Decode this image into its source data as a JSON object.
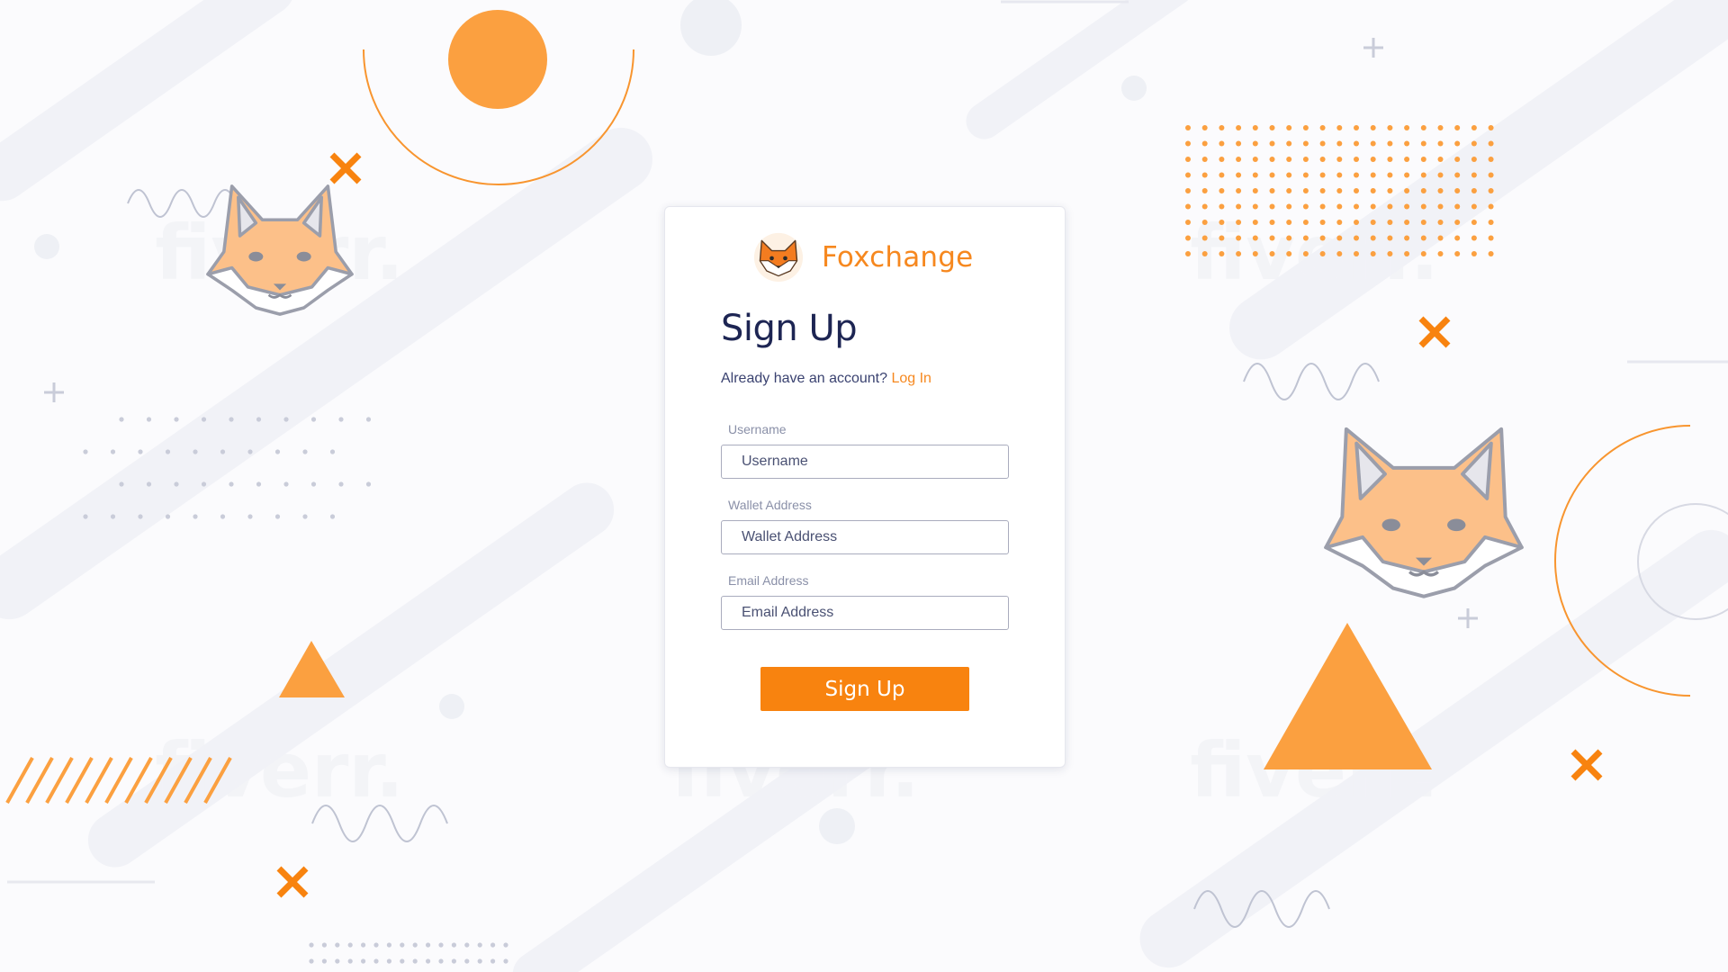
{
  "brand": {
    "name": "Foxchange",
    "logo_icon": "fox-head-icon"
  },
  "signup": {
    "title": "Sign Up",
    "login_prompt": "Already have an account?",
    "login_link": "Log In",
    "fields": [
      {
        "label": "Username",
        "placeholder": "Username",
        "value": ""
      },
      {
        "label": "Wallet Address",
        "placeholder": "Wallet Address",
        "value": ""
      },
      {
        "label": "Email Address",
        "placeholder": "Email Address",
        "value": ""
      }
    ],
    "submit_label": "Sign Up"
  },
  "colors": {
    "accent": "#f8830f",
    "title": "#1d2553",
    "background": "#fbfbfd"
  },
  "decorations": {
    "watermark": "fiverr.",
    "icons": [
      "fox-mascot-icon",
      "circle-icon",
      "triangle-icon",
      "cross-icon",
      "plus-icon",
      "wave-icon",
      "dot-grid-icon",
      "stripes-icon"
    ]
  }
}
